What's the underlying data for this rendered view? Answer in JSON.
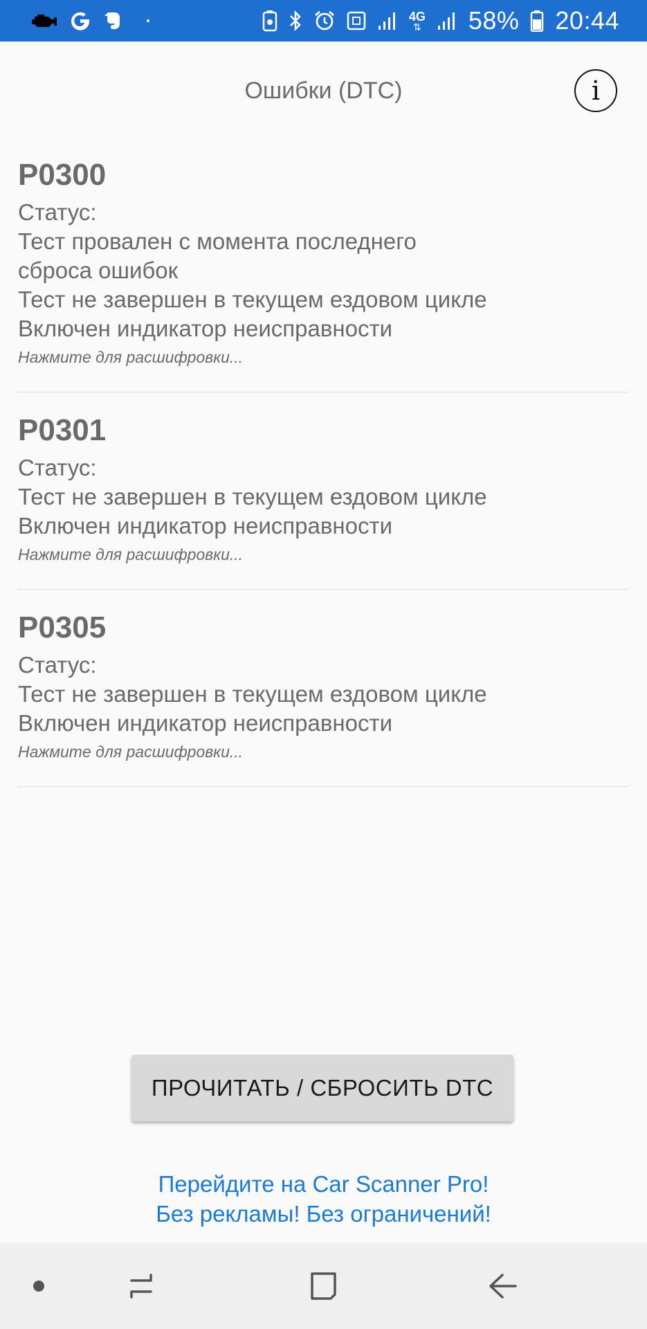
{
  "status_bar": {
    "battery_percent": "58%",
    "time": "20:44",
    "network": "4G",
    "icons_left": [
      "engine-icon",
      "google-icon",
      "evernote-icon"
    ],
    "icons_right": [
      "data-saver-icon",
      "bluetooth-icon",
      "alarm-icon",
      "nfc-icon",
      "signal-icon",
      "signal-icon",
      "battery-icon"
    ]
  },
  "header": {
    "title": "Ошибки (DTC)",
    "info_label": "i"
  },
  "dtcs": [
    {
      "code": "P0300",
      "status_label": "Статус:",
      "lines": [
        "Тест провален с момента последнего",
        "сброса ошибок",
        "Тест не завершен в текущем ездовом цикле",
        "Включен индикатор неисправности"
      ],
      "hint": "Нажмите для расшифровки..."
    },
    {
      "code": "P0301",
      "status_label": "Статус:",
      "lines": [
        "Тест не завершен в текущем ездовом цикле",
        "Включен индикатор неисправности"
      ],
      "hint": "Нажмите для расшифровки..."
    },
    {
      "code": "P0305",
      "status_label": "Статус:",
      "lines": [
        "Тест не завершен в текущем ездовом цикле",
        "Включен индикатор неисправности"
      ],
      "hint": "Нажмите для расшифровки..."
    }
  ],
  "button": {
    "label": "ПРОЧИТАТЬ / СБРОСИТЬ DTC"
  },
  "promo": {
    "line1": "Перейдите на Car Scanner Pro!",
    "line2": "Без рекламы! Без ограничений!"
  },
  "colors": {
    "status_bar": "#1f6fd1",
    "background": "#fafafa",
    "text_gray": "#6a6a6a",
    "button": "#d9d9d9",
    "link": "#1a7ad4",
    "nav_bar": "#efefef"
  }
}
